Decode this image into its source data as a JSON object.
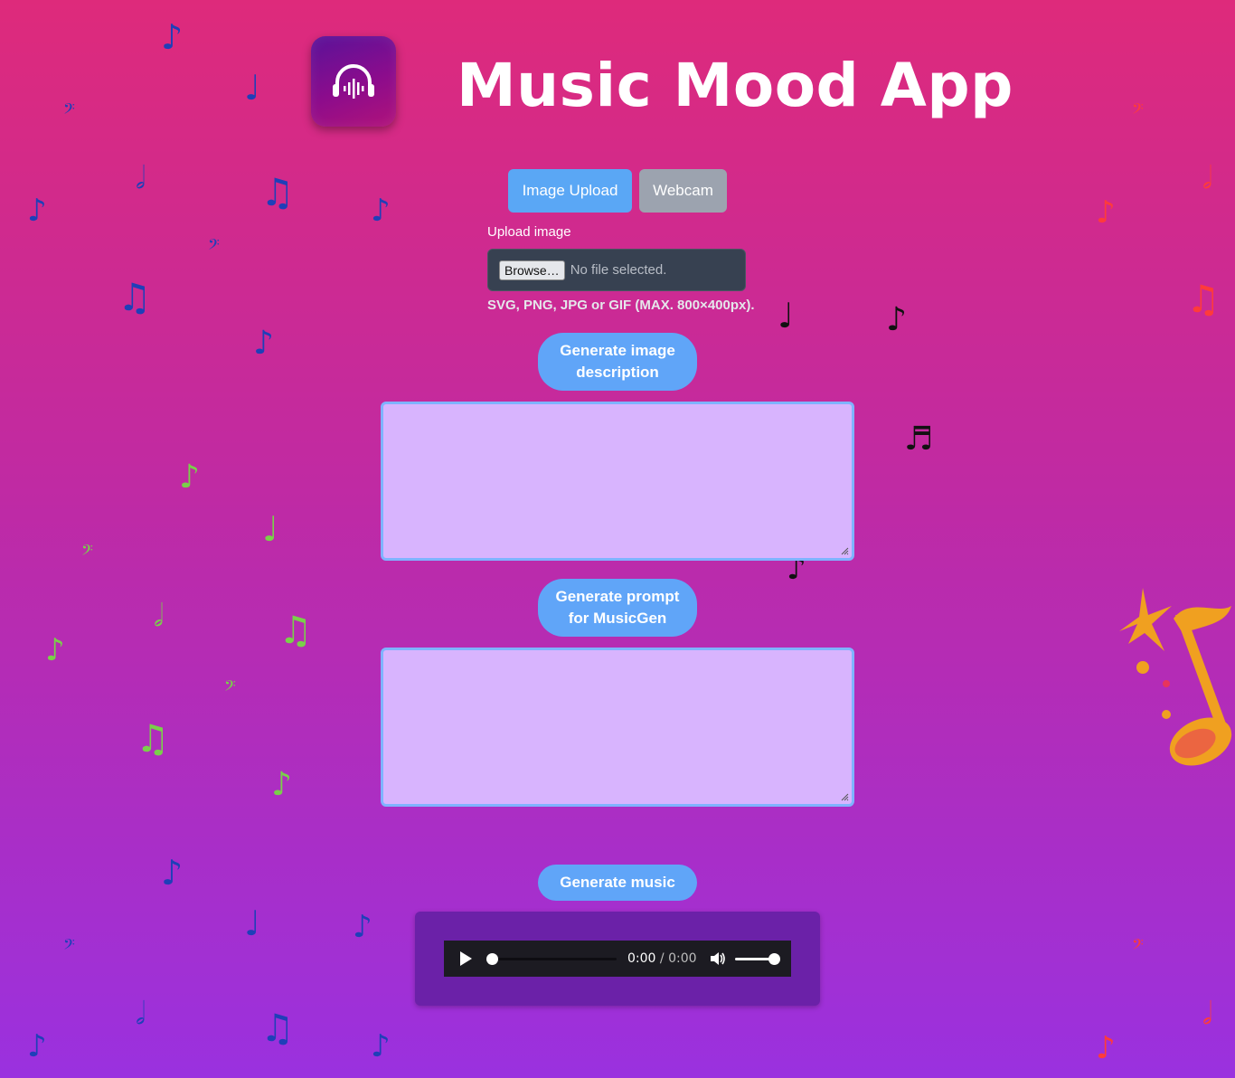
{
  "header": {
    "title": "Music Mood App",
    "logo_icon": "headphones-waveform-icon"
  },
  "tabs": [
    {
      "label": "Image Upload",
      "active": true
    },
    {
      "label": "Webcam",
      "active": false
    }
  ],
  "upload": {
    "label": "Upload image",
    "browse_label": "Browse…",
    "no_file_text": "No file selected.",
    "hint": "SVG, PNG, JPG or GIF (MAX. 800×400px)."
  },
  "buttons": {
    "generate_description": "Generate image description",
    "generate_prompt": "Generate prompt for MusicGen",
    "generate_music": "Generate music"
  },
  "textareas": {
    "description_value": "",
    "prompt_value": ""
  },
  "audio": {
    "current_time": "0:00",
    "separator": " / ",
    "duration": "0:00"
  },
  "colors": {
    "accent_button": "#60a5f8",
    "tab_active": "#5aa7f5",
    "tab_inactive": "#9ca3af",
    "textarea_bg": "#d8b4fe",
    "player_panel": "#6b21a8"
  }
}
